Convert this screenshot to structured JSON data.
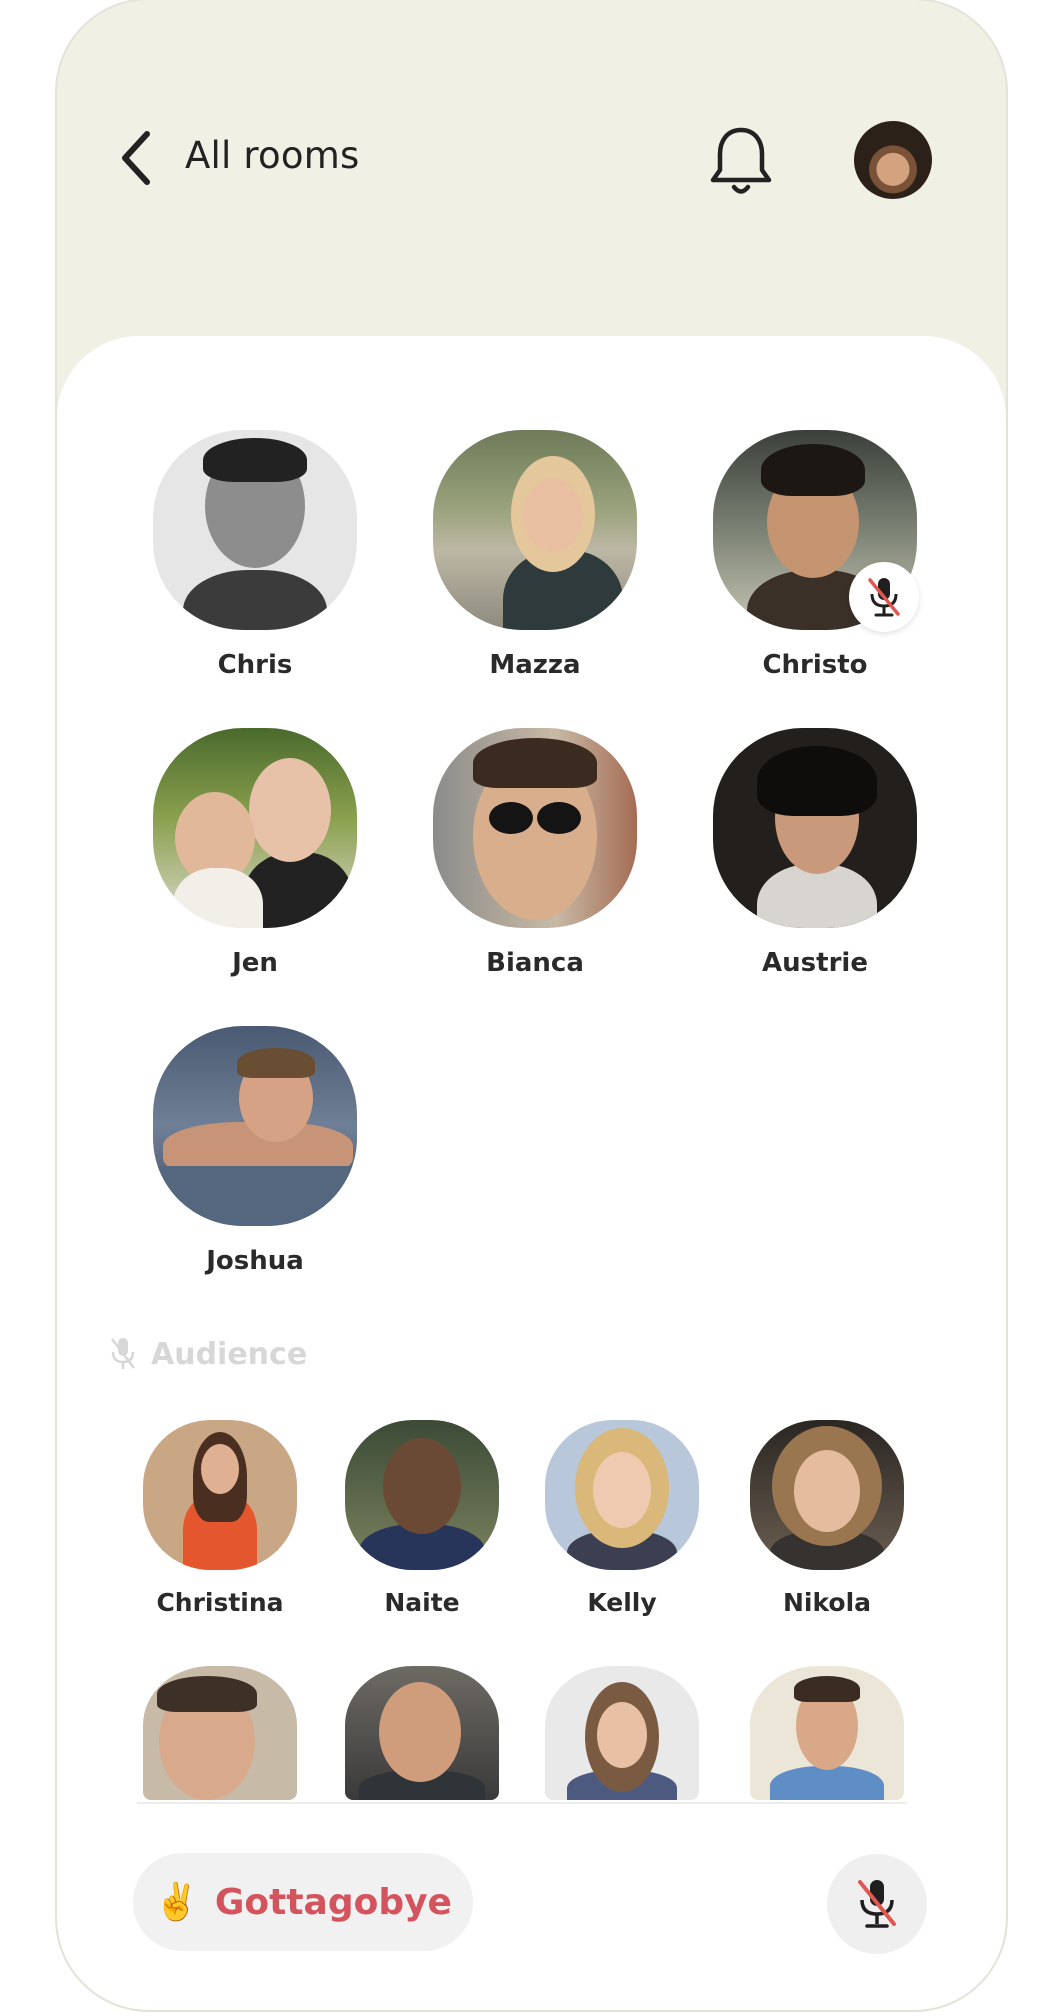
{
  "header": {
    "back_label": "All rooms"
  },
  "speakers": [
    {
      "name": "Chris",
      "muted": false
    },
    {
      "name": "Mazza",
      "muted": false
    },
    {
      "name": "Christo",
      "muted": true
    },
    {
      "name": "Jen",
      "muted": false
    },
    {
      "name": "Bianca",
      "muted": false
    },
    {
      "name": "Austrie",
      "muted": false
    },
    {
      "name": "Joshua",
      "muted": false
    }
  ],
  "audience": {
    "label": "Audience",
    "members": [
      {
        "name": "Christina"
      },
      {
        "name": "Naite"
      },
      {
        "name": "Kelly"
      },
      {
        "name": "Nikola"
      },
      {
        "name": ""
      },
      {
        "name": ""
      },
      {
        "name": ""
      },
      {
        "name": ""
      }
    ]
  },
  "footer": {
    "leave_emoji": "✌️",
    "leave_label": "Gottagobye"
  },
  "colors": {
    "header_bg": "#f1f0e5",
    "leave_text": "#d4545e",
    "mute_slash": "#e0574f"
  },
  "icons": {
    "back": "chevron-left-icon",
    "notifications": "bell-icon",
    "muted": "mic-muted-icon",
    "audience": "mic-off-icon"
  }
}
